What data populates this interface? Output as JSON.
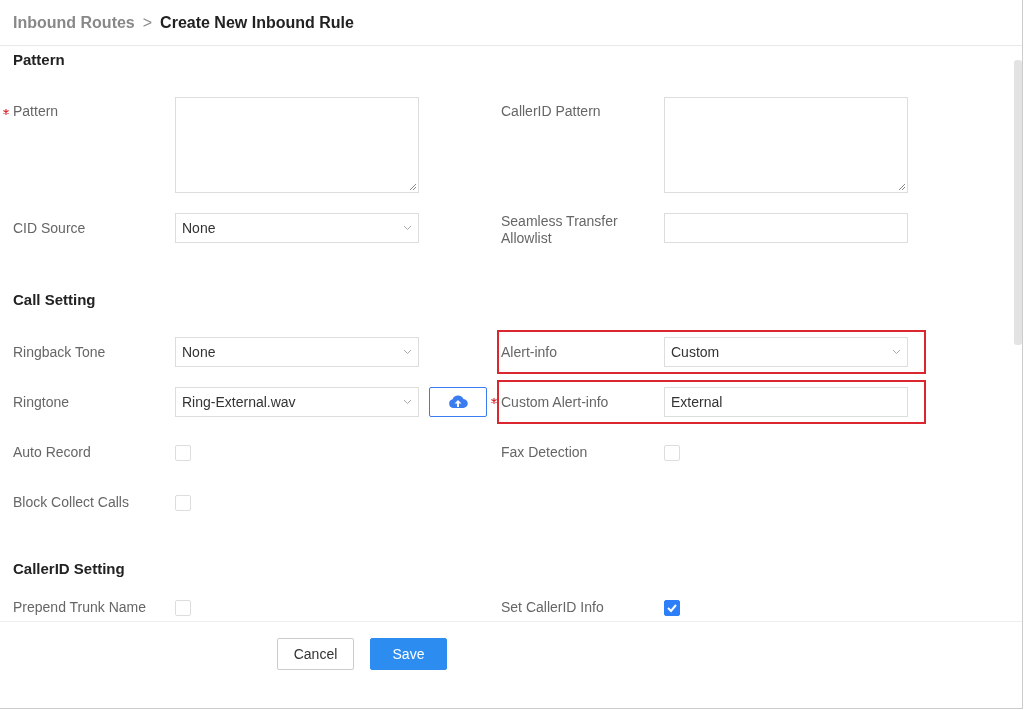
{
  "breadcrumb": {
    "parent": "Inbound Routes",
    "separator": ">",
    "current": "Create New Inbound Rule"
  },
  "sections": [
    {
      "title": "Pattern",
      "rows": [
        {
          "left": {
            "label": "Pattern",
            "required": true,
            "kind": "textarea"
          },
          "right": {
            "label": "CallerID Pattern",
            "kind": "textarea",
            "highlighted": false
          }
        },
        {
          "left": {
            "label": "CID Source",
            "kind": "select",
            "value": "None"
          },
          "right": {
            "label": "Seamless Transfer Allowlist",
            "kind": "input",
            "highlighted": false
          }
        }
      ]
    },
    {
      "title": "Call Setting",
      "rows": [
        {
          "left": {
            "label": "Ringback Tone",
            "kind": "select",
            "value": "None"
          },
          "right": {
            "label": "Alert-info",
            "kind": "select",
            "value": "Custom",
            "highlighted": true
          }
        },
        {
          "left": {
            "label": "Ringtone",
            "kind": "select",
            "value": "Ring-External.wav",
            "upload": true
          },
          "right": {
            "label": "Custom Alert-info",
            "required": true,
            "kind": "input",
            "value": "External",
            "highlighted": true
          }
        },
        {
          "left": {
            "label": "Auto Record",
            "kind": "checkbox",
            "checked": false
          },
          "right": {
            "label": "Fax Detection",
            "kind": "checkbox",
            "checked": false,
            "highlighted": false
          }
        },
        {
          "left": {
            "label": "Block Collect Calls",
            "kind": "checkbox",
            "checked": false
          }
        }
      ]
    },
    {
      "title": "CallerID Setting",
      "rows": [
        {
          "left": {
            "label": "Prepend Trunk Name",
            "kind": "checkbox",
            "checked": false
          },
          "right": {
            "label": "Set CallerID Info",
            "kind": "checkbox",
            "checked": true,
            "highlighted": false
          }
        }
      ]
    }
  ],
  "buttons": [
    {
      "label": "Cancel",
      "kind": "secondary"
    },
    {
      "label": "Save",
      "kind": "primary"
    }
  ]
}
